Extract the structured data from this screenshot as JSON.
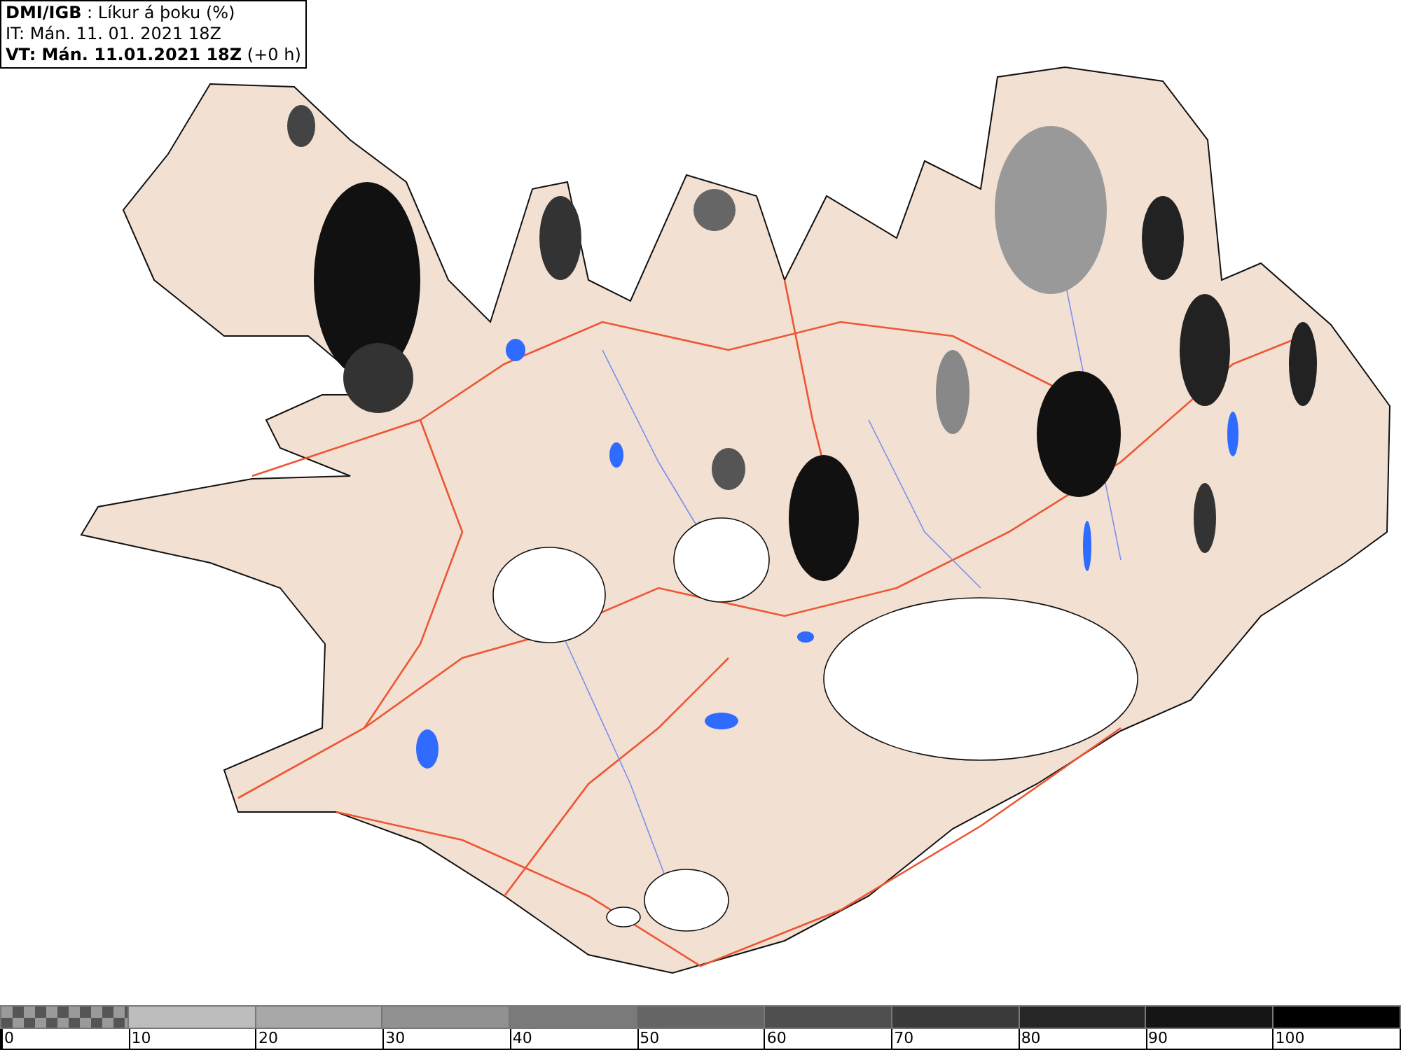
{
  "header": {
    "title": "**DMI/IGB** : Líkur á þoku (%)",
    "issue_time": "IT: Mán. 11. 01. 2021 18Z",
    "valid_time": "**VT: Mán. 11.01.2021 18Z** (+0 h)"
  },
  "legend": {
    "segments": [
      {
        "kind": "pattern",
        "color": "#9a9a9a"
      },
      {
        "kind": "solid",
        "color": "#bdbdbd"
      },
      {
        "kind": "solid",
        "color": "#a8a8a8"
      },
      {
        "kind": "solid",
        "color": "#919191"
      },
      {
        "kind": "solid",
        "color": "#7a7a7a"
      },
      {
        "kind": "solid",
        "color": "#656565"
      },
      {
        "kind": "solid",
        "color": "#4f4f4f"
      },
      {
        "kind": "solid",
        "color": "#3a3a3a"
      },
      {
        "kind": "solid",
        "color": "#262626"
      },
      {
        "kind": "solid",
        "color": "#151515"
      },
      {
        "kind": "solid",
        "color": "#000000"
      }
    ],
    "labels": [
      "0",
      "10",
      "20",
      "30",
      "40",
      "50",
      "60",
      "70",
      "80",
      "90",
      "100"
    ]
  }
}
